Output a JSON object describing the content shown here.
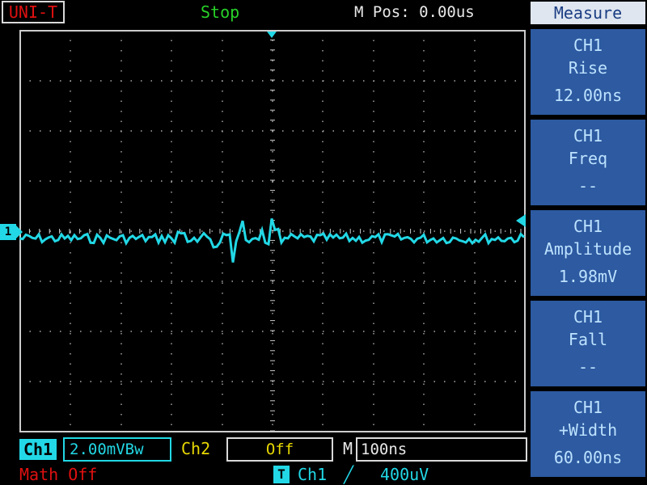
{
  "header": {
    "brand": "UNI-T",
    "status": "Stop",
    "position": "M Pos: 0.00us"
  },
  "measure_menu": {
    "title": "Measure",
    "items": [
      {
        "channel": "CH1",
        "name": "Rise",
        "value": "12.00ns"
      },
      {
        "channel": "CH1",
        "name": "Freq",
        "value": "--"
      },
      {
        "channel": "CH1",
        "name": "Amplitude",
        "value": "1.98mV"
      },
      {
        "channel": "CH1",
        "name": "Fall",
        "value": "--"
      },
      {
        "channel": "CH1",
        "name": "+Width",
        "value": "60.00ns"
      }
    ]
  },
  "bottom": {
    "ch1_label": "Ch1",
    "ch1_scale": "2.00mVBw",
    "ch2_label": "Ch2",
    "ch2_value": "Off",
    "m_label": "M",
    "timebase": "100ns",
    "math": "Math Off",
    "trigger_mode_badge": "T",
    "trigger_source": "Ch1",
    "trigger_edge": "╱",
    "trigger_level": "400uV"
  },
  "display": {
    "ch1_marker": "1",
    "colors": {
      "grid": "#cccccc",
      "trace": "#22d8e6",
      "trigger_marker": "#22d8e6"
    }
  }
}
